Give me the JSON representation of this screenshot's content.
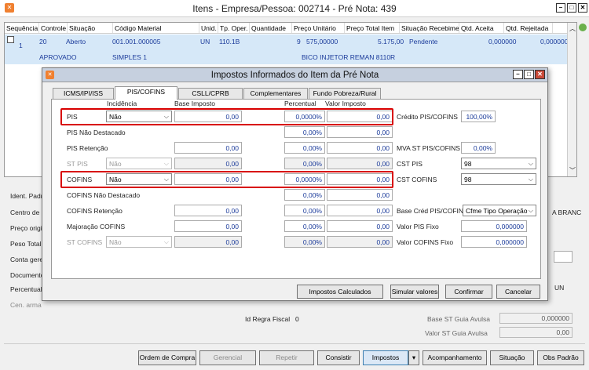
{
  "window": {
    "title": "Itens - Empresa/Pessoa: 002714 - Pré Nota: 439"
  },
  "grid": {
    "columns": [
      "Sequência",
      "Controle",
      "Situação",
      "Código Material",
      "Unid.",
      "Tp. Oper.",
      "Quantidade",
      "Preço Unitário",
      "Preço Total Item",
      "Situação Recebimen.",
      "Qtd. Aceita",
      "Qtd. Rejeitada"
    ],
    "row": {
      "seq": "1",
      "controle": "20",
      "situacao": "Aberto",
      "codigo": "001.001.000005",
      "unid": "UN",
      "tpoper": "110.1B",
      "quantidade": "9",
      "preco_unit": "575,00000",
      "preco_total": "5.175,00",
      "sit_receb": "Pendente",
      "qtd_aceita": "0,000000",
      "qtd_rejeitada": "0,000000",
      "sub1": "APROVADO",
      "sub2": "SIMPLES 1",
      "sub3": "BICO INJETOR REMAN 8110R"
    }
  },
  "bg": {
    "labels": [
      "Ident. Padr",
      "Centro de",
      "Preço origi",
      "Peso Total",
      "Conta gere",
      "Documento",
      "Percentual",
      "Cen. arma"
    ],
    "right_text": "A BRANC",
    "right_un": "UN",
    "id_regra_label": "Id Regra Fiscal",
    "id_regra_value": "0",
    "base_st_label": "Base ST Guia Avulsa",
    "base_st_value": "0,000000",
    "valor_st_label": "Valor ST Guia Avulsa",
    "valor_st_value": "0,00"
  },
  "bottom_buttons": [
    "Ordem de Compra",
    "Gerencial",
    "Repetir",
    "Consistir",
    "Impostos",
    "Acompanhamento",
    "Situação",
    "Obs Padrão"
  ],
  "dialog": {
    "title": "Impostos Informados do Item da Pré Nota",
    "tabs": [
      "ICMS/IPI/ISS",
      "PIS/COFINS",
      "CSLL/CPRB",
      "Complementares",
      "Fundo Pobreza/Rural"
    ],
    "headers": {
      "incidencia": "Incidência",
      "base": "Base Imposto",
      "percentual": "Percentual",
      "valor": "Valor Imposto"
    },
    "rows": {
      "pis": {
        "label": "PIS",
        "inc": "Não",
        "base": "0,00",
        "perc": "0,0000%",
        "valor": "0,00"
      },
      "pis_nd": {
        "label": "PIS Não Destacado",
        "perc": "0,00%",
        "valor": "0,00"
      },
      "pis_ret": {
        "label": "PIS Retenção",
        "base": "0,00",
        "perc": "0,00%",
        "valor": "0,00"
      },
      "st_pis": {
        "label": "ST PIS",
        "inc": "Não",
        "base": "0,00",
        "perc": "0,00%",
        "valor": "0,00"
      },
      "cofins": {
        "label": "COFINS",
        "inc": "Não",
        "base": "0,00",
        "perc": "0,0000%",
        "valor": "0,00"
      },
      "cofins_nd": {
        "label": "COFINS Não Destacado",
        "perc": "0,00%",
        "valor": "0,00"
      },
      "cofins_ret": {
        "label": "COFINS Retenção",
        "base": "0,00",
        "perc": "0,00%",
        "valor": "0,00"
      },
      "maj_cofins": {
        "label": "Majoração COFINS",
        "base": "0,00",
        "perc": "0,00%",
        "valor": "0,00"
      },
      "st_cofins": {
        "label": "ST COFINS",
        "inc": "Não",
        "base": "0,00",
        "perc": "0,00%",
        "valor": "0,00"
      }
    },
    "right": {
      "credito_label": "Crédito PIS/COFINS",
      "credito_value": "100,00%",
      "mva_label": "MVA ST PIS/COFINS",
      "mva_value": "0,00%",
      "cst_pis_label": "CST PIS",
      "cst_pis_value": "98",
      "cst_cofins_label": "CST COFINS",
      "cst_cofins_value": "98",
      "base_cred_label": "Base Créd PIS/COFINS",
      "base_cred_value": "Cfme Tipo Operação",
      "pis_fixo_label": "Valor PIS Fixo",
      "pis_fixo_value": "0,000000",
      "cofins_fixo_label": "Valor COFINS Fixo",
      "cofins_fixo_value": "0,000000"
    },
    "buttons": [
      "Impostos Calculados",
      "Simular valores",
      "Confirmar",
      "Cancelar"
    ]
  }
}
